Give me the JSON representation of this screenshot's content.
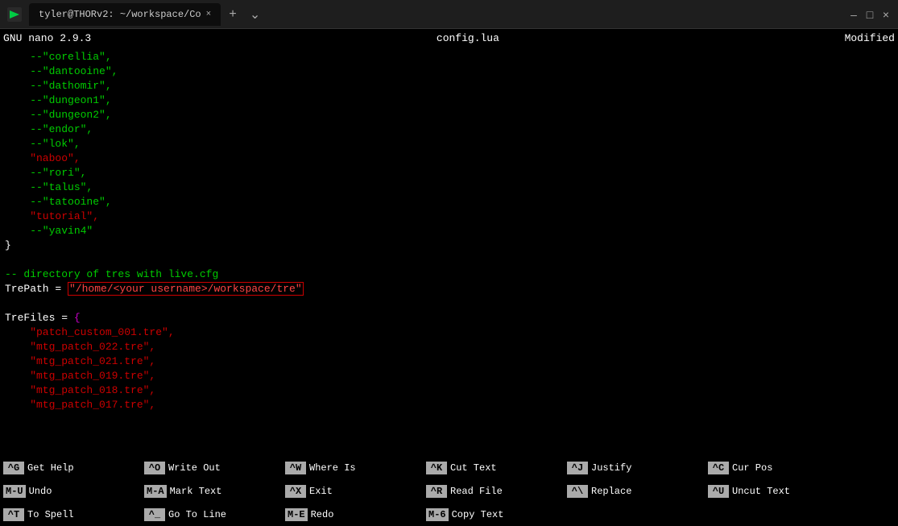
{
  "titlebar": {
    "tab_label": "tyler@THORv2: ~/workspace/Co",
    "close_label": "×",
    "new_tab_label": "+",
    "dropdown_label": "⌄",
    "win_min": "–",
    "win_max": "□",
    "win_close": "×"
  },
  "nano_header": {
    "version": "GNU nano 2.9.3",
    "filename": "config.lua",
    "modified": "Modified"
  },
  "editor": {
    "lines": [
      {
        "text": "    --\"corellia\",",
        "parts": [
          {
            "t": "    --\"corellia\",",
            "c": "green"
          }
        ]
      },
      {
        "text": "    --\"dantooine\",",
        "parts": [
          {
            "t": "    --\"dantooine\",",
            "c": "green"
          }
        ]
      },
      {
        "text": "    --\"dathomir\",",
        "parts": [
          {
            "t": "    --\"dathomir\",",
            "c": "green"
          }
        ]
      },
      {
        "text": "    --\"dungeon1\",",
        "parts": [
          {
            "t": "    --\"dungeon1\",",
            "c": "green"
          }
        ]
      },
      {
        "text": "    --\"dungeon2\",",
        "parts": [
          {
            "t": "    --\"dungeon2\",",
            "c": "green"
          }
        ]
      },
      {
        "text": "    --\"endor\",",
        "parts": [
          {
            "t": "    --\"endor\",",
            "c": "green"
          }
        ]
      },
      {
        "text": "    --\"lok\",",
        "parts": [
          {
            "t": "    --\"lok\",",
            "c": "green"
          }
        ]
      },
      {
        "text": "    \"naboo\",",
        "parts": [
          {
            "t": "    \"naboo\",",
            "c": "red"
          }
        ]
      },
      {
        "text": "    --\"rori\",",
        "parts": [
          {
            "t": "    --\"rori\",",
            "c": "green"
          }
        ]
      },
      {
        "text": "    --\"talus\",",
        "parts": [
          {
            "t": "    --\"talus\",",
            "c": "green"
          }
        ]
      },
      {
        "text": "    --\"tatooine\",",
        "parts": [
          {
            "t": "    --\"tatooine\",",
            "c": "green"
          }
        ]
      },
      {
        "text": "    \"tutorial\",",
        "parts": [
          {
            "t": "    \"tutorial\",",
            "c": "red"
          }
        ]
      },
      {
        "text": "    --\"yavin4\"",
        "parts": [
          {
            "t": "    --\"yavin4\"",
            "c": "green"
          }
        ]
      },
      {
        "text": "}",
        "parts": [
          {
            "t": "}",
            "c": "white"
          }
        ]
      },
      {
        "text": "",
        "parts": []
      },
      {
        "text": "-- directory of tres with live.cfg",
        "parts": [
          {
            "t": "-- directory of tres with live.cfg",
            "c": "green"
          }
        ]
      },
      {
        "text": "TrePath = ",
        "parts": [
          {
            "t": "TrePath = ",
            "c": "white"
          },
          {
            "t": "\"/home/<your username>/workspace/tre\"",
            "c": "bright-red",
            "highlighted": true
          }
        ]
      },
      {
        "text": "",
        "parts": []
      },
      {
        "text": "TreFiles = {",
        "parts": [
          {
            "t": "TreFiles = ",
            "c": "white"
          },
          {
            "t": "{",
            "c": "magenta"
          }
        ]
      },
      {
        "text": "    \"patch_custom_001.tre\",",
        "parts": [
          {
            "t": "    \"patch_custom_001.tre\",",
            "c": "red"
          }
        ]
      },
      {
        "text": "    \"mtg_patch_022.tre\",",
        "parts": [
          {
            "t": "    \"mtg_patch_022.tre\",",
            "c": "red"
          }
        ]
      },
      {
        "text": "    \"mtg_patch_021.tre\",",
        "parts": [
          {
            "t": "    \"mtg_patch_021.tre\",",
            "c": "red"
          }
        ]
      },
      {
        "text": "    \"mtg_patch_019.tre\",",
        "parts": [
          {
            "t": "    \"mtg_patch_019.tre\",",
            "c": "red"
          }
        ]
      },
      {
        "text": "    \"mtg_patch_018.tre\",",
        "parts": [
          {
            "t": "    \"mtg_patch_018.tre\",",
            "c": "red"
          }
        ]
      },
      {
        "text": "    \"mtg_patch_017.tre\",",
        "parts": [
          {
            "t": "    \"mtg_patch_017.tre\",",
            "c": "red"
          }
        ]
      }
    ]
  },
  "shortcuts": [
    {
      "key": "^G",
      "label": "Get Help"
    },
    {
      "key": "^O",
      "label": "Write Out"
    },
    {
      "key": "^W",
      "label": "Where Is"
    },
    {
      "key": "^K",
      "label": "Cut Text"
    },
    {
      "key": "^J",
      "label": "Justify"
    },
    {
      "key": "^C",
      "label": "Cur Pos"
    },
    {
      "key": "M-U",
      "label": "Undo"
    },
    {
      "key": "M-A",
      "label": "Mark Text"
    },
    {
      "key": "^X",
      "label": "Exit"
    },
    {
      "key": "^R",
      "label": "Read File"
    },
    {
      "key": "^\\",
      "label": "Replace"
    },
    {
      "key": "^U",
      "label": "Uncut Text"
    },
    {
      "key": "^T",
      "label": "To Spell"
    },
    {
      "key": "^_",
      "label": "Go To Line"
    },
    {
      "key": "M-E",
      "label": "Redo"
    },
    {
      "key": "M-6",
      "label": "Copy Text"
    }
  ]
}
